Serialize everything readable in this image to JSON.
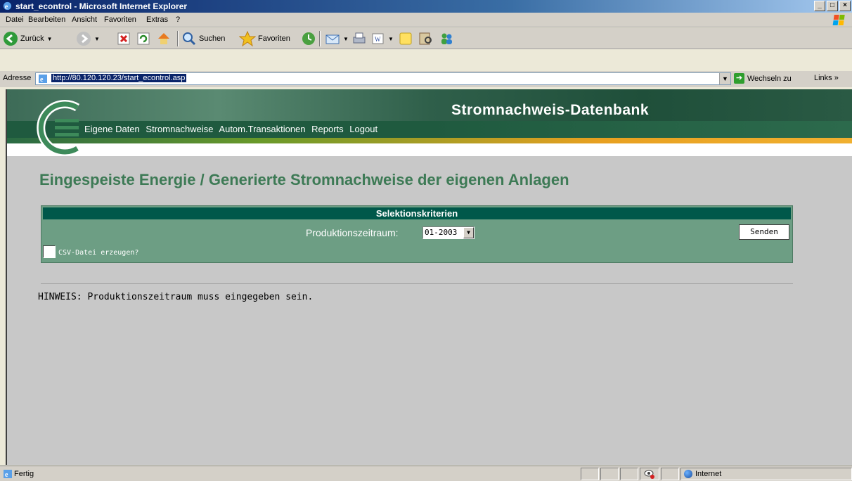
{
  "window": {
    "title": "start_econtrol - Microsoft Internet Explorer"
  },
  "menu": [
    "Datei",
    "Bearbeiten",
    "Ansicht",
    "Favoriten",
    "Extras",
    "?"
  ],
  "toolbar": {
    "back_label": "Zurück",
    "search_label": "Suchen",
    "favorites_label": "Favoriten"
  },
  "address": {
    "label": "Adresse",
    "url": "http://80.120.120.23/start_econtrol.asp",
    "go_label": "Wechseln zu",
    "links_label": "Links"
  },
  "banner": {
    "site_title": "Stromnachweis-Datenbank",
    "nav": [
      "Eigene Daten",
      "Stromnachweise",
      "Autom.Transaktionen",
      "Reports",
      "Logout"
    ]
  },
  "main": {
    "heading": "Eingespeiste Energie / Generierte Stromnachweise der eigenen Anlagen",
    "selection": {
      "header": "Selektionskriterien",
      "period_label": "Produktionszeitraum:",
      "period_value": "01-2003",
      "submit_label": "Senden",
      "csv_label": "CSV-Datei erzeugen?",
      "csv_checked": false
    },
    "hint": "HINWEIS: Produktionszeitraum muss eingegeben sein."
  },
  "status": {
    "text": "Fertig",
    "zone": "Internet"
  },
  "colors": {
    "accent_green": "#3d7a55",
    "header_dark": "#00584a",
    "panel_green": "#6d9e84"
  }
}
